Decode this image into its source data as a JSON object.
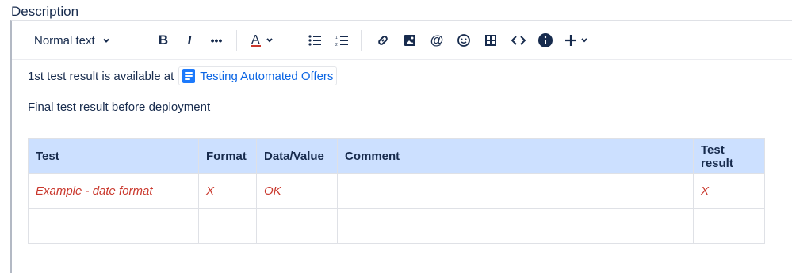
{
  "field": {
    "label": "Description"
  },
  "toolbar": {
    "text_style": "Normal text",
    "icons": [
      "chevron-down-icon",
      "bold-icon",
      "italic-icon",
      "more-formatting-icon",
      "text-color-icon",
      "bullet-list-icon",
      "numbered-list-icon",
      "link-icon",
      "image-icon",
      "mention-icon",
      "emoji-icon",
      "table-icon",
      "code-icon",
      "info-icon",
      "insert-icon"
    ]
  },
  "content": {
    "line1_prefix": "1st test result is available at",
    "smart_link": "Testing Automated Offers",
    "line2": "Final test result before deployment",
    "table": {
      "headers": [
        "Test",
        "Format",
        "Data/Value",
        "Comment",
        "Test result"
      ],
      "rows": [
        [
          "Example - date format",
          "X",
          "OK",
          "",
          "X"
        ],
        [
          "",
          "",
          "",
          "",
          ""
        ]
      ]
    }
  },
  "colors": {
    "header_bg": "#CCE0FF",
    "link": "#0C66E4",
    "error_text": "#C9372C"
  }
}
